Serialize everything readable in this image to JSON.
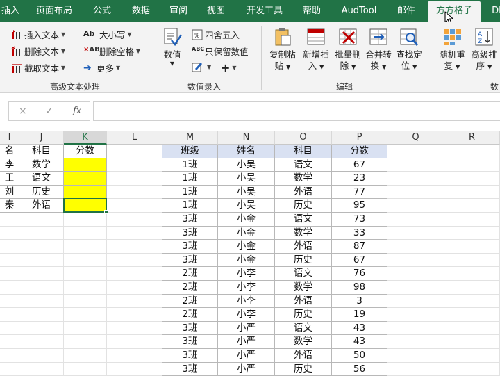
{
  "tabs": [
    "插入",
    "页面布局",
    "公式",
    "数据",
    "审阅",
    "视图",
    "开发工具",
    "帮助",
    "AudTool",
    "邮件",
    "方方格子",
    "DI"
  ],
  "ribbon": {
    "text_group": {
      "insert_text": "插入文本",
      "delete_text": "删除文本",
      "cut_text": "截取文本",
      "case": "大小写",
      "delete_space": "删除空格",
      "more": "更多",
      "label": "高级文本处理"
    },
    "number_group": {
      "numeric_line1": "数值",
      "round": "四舍五入",
      "keep_numbers": "只保留数值",
      "label": "数值录入"
    },
    "edit_group": {
      "copy_paste": [
        "复制粘",
        "贴"
      ],
      "add_insert": [
        "新增插",
        "入"
      ],
      "batch_delete": [
        "批量删",
        "除"
      ],
      "merge_convert": [
        "合并转",
        "换"
      ],
      "find_locate": [
        "查找定",
        "位"
      ],
      "label": "编辑"
    },
    "last_group": {
      "random_repeat": [
        "随机重",
        "复"
      ],
      "advanced_sort": [
        "高级排",
        "序"
      ],
      "label": "数"
    }
  },
  "formula_bar": {
    "cancel_icon": "×",
    "enter_icon": "✓",
    "fx_label": "fx",
    "value": ""
  },
  "columns": [
    "I",
    "J",
    "K",
    "L",
    "M",
    "N",
    "O",
    "P",
    "Q",
    "R"
  ],
  "left_table": {
    "headers": [
      "名",
      "科目",
      "分数"
    ],
    "rows": [
      [
        "李",
        "数学",
        ""
      ],
      [
        "王",
        "语文",
        ""
      ],
      [
        "刘",
        "历史",
        ""
      ],
      [
        "秦",
        "外语",
        ""
      ]
    ]
  },
  "right_table": {
    "headers": [
      "班级",
      "姓名",
      "科目",
      "分数"
    ],
    "rows": [
      [
        "1班",
        "小吴",
        "语文",
        "67"
      ],
      [
        "1班",
        "小吴",
        "数学",
        "23"
      ],
      [
        "1班",
        "小吴",
        "外语",
        "77"
      ],
      [
        "1班",
        "小吴",
        "历史",
        "95"
      ],
      [
        "3班",
        "小金",
        "语文",
        "73"
      ],
      [
        "3班",
        "小金",
        "数学",
        "33"
      ],
      [
        "3班",
        "小金",
        "外语",
        "87"
      ],
      [
        "3班",
        "小金",
        "历史",
        "67"
      ],
      [
        "2班",
        "小李",
        "语文",
        "76"
      ],
      [
        "2班",
        "小李",
        "数学",
        "98"
      ],
      [
        "2班",
        "小李",
        "外语",
        "3"
      ],
      [
        "2班",
        "小李",
        "历史",
        "19"
      ],
      [
        "3班",
        "小严",
        "语文",
        "43"
      ],
      [
        "3班",
        "小严",
        "数学",
        "43"
      ],
      [
        "3班",
        "小严",
        "外语",
        "50"
      ],
      [
        "3班",
        "小严",
        "历史",
        "56"
      ]
    ]
  },
  "colors": {
    "excel_green": "#217346",
    "highlight_yellow": "#ffff00",
    "table_header_blue": "#d9e1f2"
  }
}
